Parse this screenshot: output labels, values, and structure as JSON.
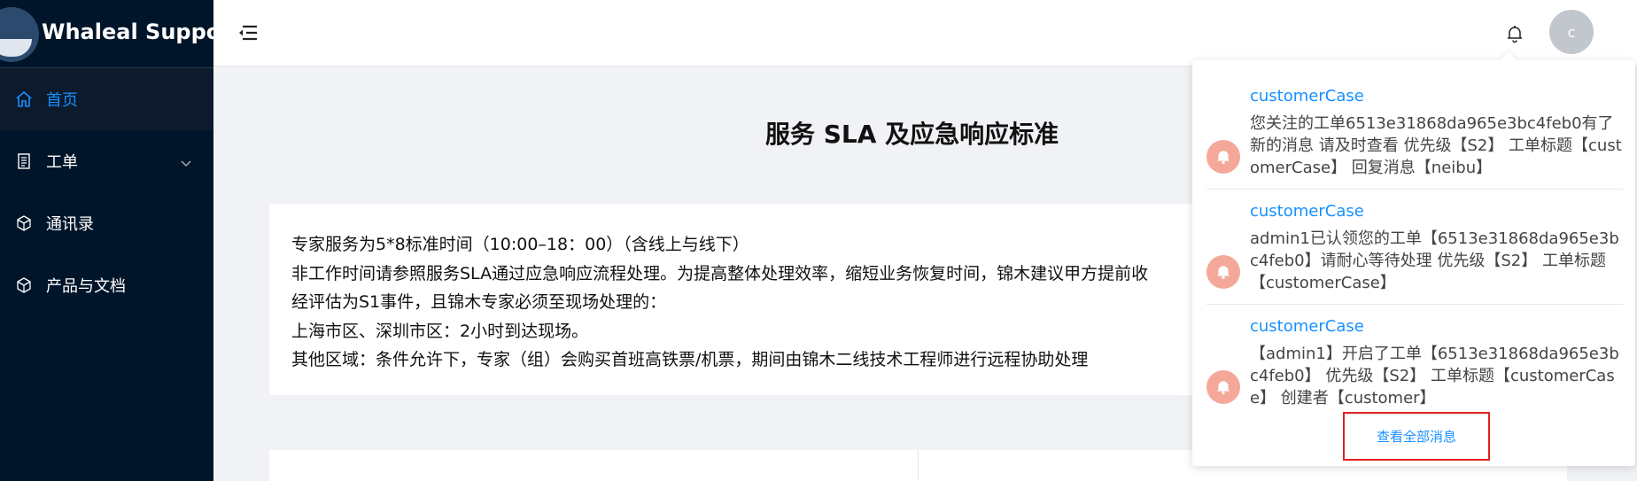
{
  "app": {
    "logo_text": "Whaleal Support"
  },
  "sidebar": {
    "items": [
      {
        "label": "首页",
        "icon": "home-icon",
        "active": true
      },
      {
        "label": "工单",
        "icon": "ticket-icon",
        "expandable": true
      },
      {
        "label": "通讯录",
        "icon": "cube-icon"
      },
      {
        "label": "产品与文档",
        "icon": "cube-icon"
      }
    ]
  },
  "header": {
    "avatar_initial": "c",
    "icons": [
      "menu-fold-icon",
      "bell-icon"
    ]
  },
  "main": {
    "title": "服务 SLA 及应急响应标准",
    "paragraphs": [
      "专家服务为5*8标准时间（10:00–18：00）（含线上与线下）",
      "非工作时间请参照服务SLA通过应急响应流程处理。为提高整体处理效率，缩短业务恢复时间，锦木建议甲方提前收",
      "经评估为S1事件，且锦木专家必须至现场处理的：",
      "上海市区、深圳市区：2小时到达现场。",
      "其他区域：条件允许下，专家（组）会购买首班高铁票/机票，期间由锦木二线技术工程师进行远程协助处理"
    ]
  },
  "notifications": {
    "items": [
      {
        "title": "customerCase",
        "body": "您关注的工单6513e31868da965e3bc4feb0有了新的消息 请及时查看 优先级【S2】 工单标题【customerCase】 回复消息【neibu】"
      },
      {
        "title": "customerCase",
        "body": "admin1已认领您的工单【6513e31868da965e3bc4feb0】请耐心等待处理 优先级【S2】 工单标题【customerCase】"
      },
      {
        "title": "customerCase",
        "body": "【admin1】开启了工单【6513e31868da965e3bc4feb0】 优先级【S2】 工单标题【customerCase】 创建者【customer】"
      }
    ],
    "view_all_label": "查看全部消息"
  },
  "colors": {
    "sidebar_bg": "#001529",
    "accent": "#1890ff",
    "highlight_border": "#e0201f",
    "notif_avatar": "#f5a899"
  }
}
